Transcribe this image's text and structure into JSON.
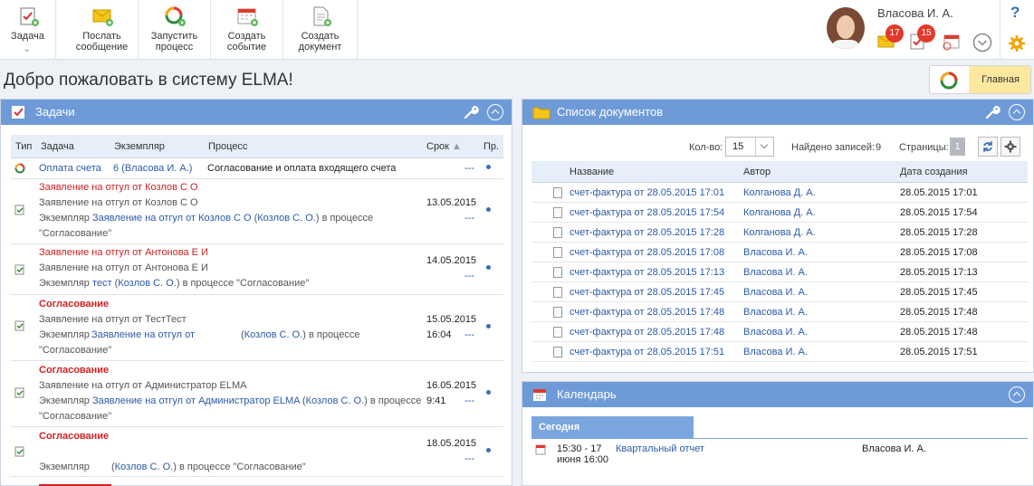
{
  "toolbar": {
    "task_label": "Задача",
    "send_message_label": "Послать сообщение",
    "start_process_label": "Запустить процесс",
    "create_event_label": "Создать событие",
    "create_document_label": "Создать документ"
  },
  "user": {
    "name": "Власова И. А.",
    "messages_count": "17",
    "tasks_count": "15"
  },
  "help_label": "?",
  "welcome_title": "Добро пожаловать в систему ELMA!",
  "main_button_label": "Главная",
  "tasks_panel": {
    "title": "Задачи",
    "headers": {
      "type": "Тип",
      "task": "Задача",
      "instance": "Экземпляр",
      "process": "Процесс",
      "deadline": "Срок",
      "priority": "Пр."
    },
    "rows": [
      {
        "task": "Оплата счета",
        "instance": "6 (Власова И. А.)",
        "process": "Согласование и оплата входящего счета",
        "date": "",
        "time": ""
      },
      {
        "title": "Заявление на отгул от Козлов С О",
        "subtitle": "Заявление на отгул от Козлов С О",
        "inst_prefix": "Экземпляр",
        "inst_link": "Заявление на отгул от Козлов С О",
        "inst_author": "Козлов С. О.",
        "inst_suffix": "в процессе",
        "process_name": "\"Согласование\"",
        "date": "13.05.2015",
        "time": ""
      },
      {
        "title": "Заявление на отгул от Антонова Е И",
        "subtitle": "Заявление на отгул от Антонова Е И",
        "inst_prefix": "Экземпляр",
        "inst_link": "тест",
        "inst_author": "Козлов С. О.",
        "inst_suffix": "в процессе \"Согласование\"",
        "date": "14.05.2015",
        "time": ""
      },
      {
        "title": "Согласование",
        "subtitle": "Заявление на отгул от ТестТест",
        "inst_prefix": "Экземпляр",
        "inst_link": "Заявление на отгул от",
        "inst_author": "Козлов С. О.",
        "inst_suffix": "в процессе",
        "process_name": "\"Согласование\"",
        "date": "15.05.2015",
        "time": "16:04"
      },
      {
        "title": "Согласование",
        "subtitle": "Заявление на отгул от Администратор ELMA",
        "inst_prefix": "Экземпляр",
        "inst_link": "Заявление на отгул от Администратор ELMA",
        "inst_author": "Козлов С. О.",
        "inst_suffix": "в процессе",
        "process_name": "\"Согласование\"",
        "date": "16.05.2015",
        "time": "9:41"
      },
      {
        "title": "Согласование",
        "inst_prefix": "Экземпляр",
        "inst_author": "Козлов С. О.",
        "inst_suffix": "в процессе \"Согласование\"",
        "date": "18.05.2015",
        "time": ""
      }
    ],
    "dash": "---"
  },
  "documents_panel": {
    "title": "Список документов",
    "count_label": "Кол-во:",
    "count_value": "15",
    "found_label": "Найдено записей:",
    "found_value": "9",
    "pages_label": "Страницы:",
    "pages_value": "1",
    "headers": {
      "name": "Название",
      "author": "Автор",
      "created": "Дата создания"
    },
    "rows": [
      {
        "name": "счет-фактура от 28.05.2015 17:01",
        "author": "Колганова Д. А.",
        "created": "28.05.2015 17:01"
      },
      {
        "name": "счет-фактура от 28.05.2015 17:54",
        "author": "Колганова Д. А.",
        "created": "28.05.2015 17:54"
      },
      {
        "name": "счет-фактура от 28.05.2015 17:28",
        "author": "Колганова Д. А.",
        "created": "28.05.2015 17:28"
      },
      {
        "name": "счет-фактура от 28.05.2015 17:08",
        "author": "Власова И. А.",
        "created": "28.05.2015 17:08"
      },
      {
        "name": "счет-фактура от 28.05.2015 17:13",
        "author": "Власова И. А.",
        "created": "28.05.2015 17:13"
      },
      {
        "name": "счет-фактура от 28.05.2015 17:45",
        "author": "Власова И. А.",
        "created": "28.05.2015 17:45"
      },
      {
        "name": "счет-фактура от 28.05.2015 17:48",
        "author": "Власова И. А.",
        "created": "28.05.2015 17:48"
      },
      {
        "name": "счет-фактура от 28.05.2015 17:48",
        "author": "Власова И. А.",
        "created": "28.05.2015 17:48"
      },
      {
        "name": "счет-фактура от 28.05.2015 17:51",
        "author": "Власова И. А.",
        "created": "28.05.2015 17:51"
      }
    ]
  },
  "calendar_panel": {
    "title": "Календарь",
    "today_label": "Сегодня",
    "event": {
      "time_line1": "15:30 - 17",
      "time_line2": "июня 16:00",
      "title": "Квартальный отчет",
      "owner": "Власова И. А."
    }
  },
  "colors": {
    "panel_header": "#6e9bd8",
    "link": "#2b5aa8",
    "badge": "#e23a2a",
    "main_button": "#fde8a0"
  }
}
